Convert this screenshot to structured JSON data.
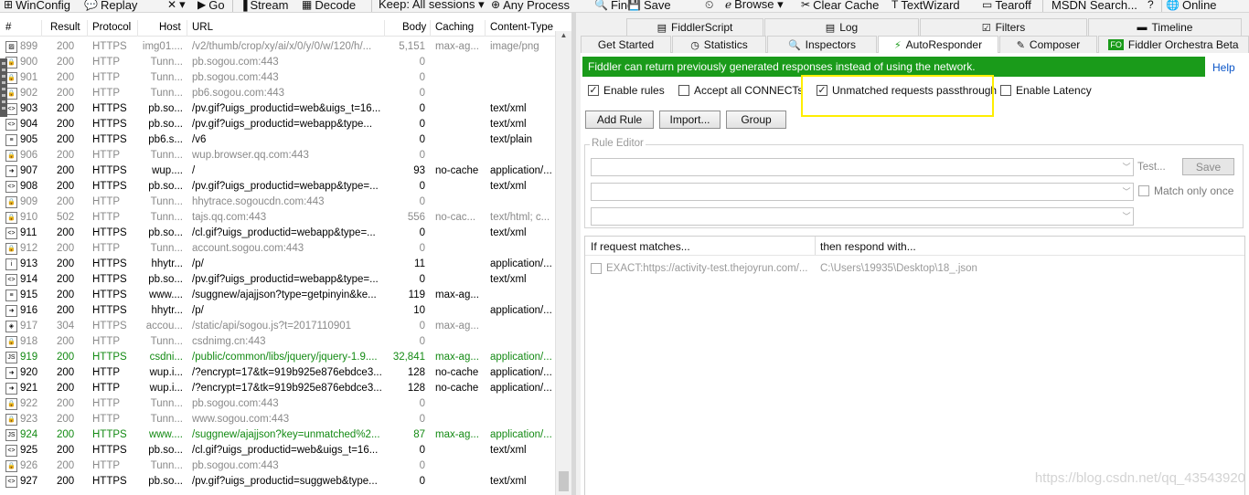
{
  "toolbar": {
    "items": [
      {
        "icon": "winconfig-icon",
        "glyph": "⊞",
        "label": "WinConfig"
      },
      {
        "icon": "replay-icon",
        "glyph": "💬",
        "label": "Replay"
      },
      {
        "icon": "remove-icon",
        "glyph": "✕",
        "label": "▾"
      },
      {
        "icon": "go-icon",
        "glyph": "▶",
        "label": "Go"
      },
      {
        "icon": "stream-icon",
        "glyph": "▐",
        "label": "Stream"
      },
      {
        "icon": "decode-icon",
        "glyph": "▦",
        "label": "Decode"
      },
      {
        "icon": "",
        "glyph": "",
        "label": "Keep: All sessions ▾"
      },
      {
        "icon": "target-icon",
        "glyph": "⊕",
        "label": "Any Process"
      },
      {
        "icon": "find-icon",
        "glyph": "🔍",
        "label": "Find"
      },
      {
        "icon": "save-icon",
        "glyph": "💾",
        "label": "Save"
      },
      {
        "icon": "timer-icon",
        "glyph": "⏲",
        "label": ""
      },
      {
        "icon": "browse-icon",
        "glyph": "ℯ",
        "label": "Browse ▾"
      },
      {
        "icon": "clear-cache-icon",
        "glyph": "✂",
        "label": "Clear Cache"
      },
      {
        "icon": "textwizard-icon",
        "glyph": "T",
        "label": "TextWizard"
      },
      {
        "icon": "tearoff-icon",
        "glyph": "▭",
        "label": "Tearoff"
      },
      {
        "icon": "",
        "glyph": "",
        "label": "MSDN Search..."
      },
      {
        "icon": "help-icon",
        "glyph": "?",
        "label": ""
      },
      {
        "icon": "online-icon",
        "glyph": "🌐",
        "label": "Online"
      }
    ]
  },
  "sessions": {
    "columns": {
      "num": "#",
      "result": "Result",
      "protocol": "Protocol",
      "host": "Host",
      "url": "URL",
      "body": "Body",
      "caching": "Caching",
      "ctype": "Content-Type"
    },
    "rows": [
      {
        "num": "899",
        "result": "200",
        "protocol": "HTTPS",
        "host": "img01....",
        "url": "/v2/thumb/crop/xy/ai/x/0/y/0/w/120/h/...",
        "body": "5,151",
        "caching": "max-ag...",
        "ctype": "image/png",
        "style": "grey",
        "icon": "image-icon",
        "glyph": "▨"
      },
      {
        "num": "900",
        "result": "200",
        "protocol": "HTTP",
        "host": "Tunn...",
        "url": "pb.sogou.com:443",
        "body": "0",
        "caching": "",
        "ctype": "",
        "style": "grey",
        "icon": "lock-icon",
        "glyph": "🔒"
      },
      {
        "num": "901",
        "result": "200",
        "protocol": "HTTP",
        "host": "Tunn...",
        "url": "pb.sogou.com:443",
        "body": "0",
        "caching": "",
        "ctype": "",
        "style": "grey",
        "icon": "lock-icon",
        "glyph": "🔒"
      },
      {
        "num": "902",
        "result": "200",
        "protocol": "HTTP",
        "host": "Tunn...",
        "url": "pb6.sogou.com:443",
        "body": "0",
        "caching": "",
        "ctype": "",
        "style": "grey",
        "icon": "lock-icon",
        "glyph": "🔒"
      },
      {
        "num": "903",
        "result": "200",
        "protocol": "HTTPS",
        "host": "pb.so...",
        "url": "/pv.gif?uigs_productid=web&uigs_t=16...",
        "body": "0",
        "caching": "",
        "ctype": "text/xml",
        "style": "",
        "icon": "xml-icon",
        "glyph": "<>"
      },
      {
        "num": "904",
        "result": "200",
        "protocol": "HTTPS",
        "host": "pb.so...",
        "url": "/pv.gif?uigs_productid=webapp&type...",
        "body": "0",
        "caching": "",
        "ctype": "text/xml",
        "style": "",
        "icon": "xml-icon",
        "glyph": "<>"
      },
      {
        "num": "905",
        "result": "200",
        "protocol": "HTTPS",
        "host": "pb6.s...",
        "url": "/v6",
        "body": "0",
        "caching": "",
        "ctype": "text/plain",
        "style": "",
        "icon": "text-icon",
        "glyph": "≡"
      },
      {
        "num": "906",
        "result": "200",
        "protocol": "HTTP",
        "host": "Tunn...",
        "url": "wup.browser.qq.com:443",
        "body": "0",
        "caching": "",
        "ctype": "",
        "style": "grey",
        "icon": "lock-icon",
        "glyph": "🔒"
      },
      {
        "num": "907",
        "result": "200",
        "protocol": "HTTPS",
        "host": "wup....",
        "url": "/",
        "body": "93",
        "caching": "no-cache",
        "ctype": "application/...",
        "style": "",
        "icon": "arrow-icon",
        "glyph": "➜"
      },
      {
        "num": "908",
        "result": "200",
        "protocol": "HTTPS",
        "host": "pb.so...",
        "url": "/pv.gif?uigs_productid=webapp&type=...",
        "body": "0",
        "caching": "",
        "ctype": "text/xml",
        "style": "",
        "icon": "xml-icon",
        "glyph": "<>"
      },
      {
        "num": "909",
        "result": "200",
        "protocol": "HTTP",
        "host": "Tunn...",
        "url": "hhytrace.sogoucdn.com:443",
        "body": "0",
        "caching": "",
        "ctype": "",
        "style": "grey",
        "icon": "lock-icon",
        "glyph": "🔒"
      },
      {
        "num": "910",
        "result": "502",
        "protocol": "HTTP",
        "host": "Tunn...",
        "url": "tajs.qq.com:443",
        "body": "556",
        "caching": "no-cac...",
        "ctype": "text/html; c...",
        "style": "grey",
        "icon": "lock-icon",
        "glyph": "🔒"
      },
      {
        "num": "911",
        "result": "200",
        "protocol": "HTTPS",
        "host": "pb.so...",
        "url": "/cl.gif?uigs_productid=webapp&type=...",
        "body": "0",
        "caching": "",
        "ctype": "text/xml",
        "style": "",
        "icon": "xml-icon",
        "glyph": "<>"
      },
      {
        "num": "912",
        "result": "200",
        "protocol": "HTTP",
        "host": "Tunn...",
        "url": "account.sogou.com:443",
        "body": "0",
        "caching": "",
        "ctype": "",
        "style": "grey",
        "icon": "lock-icon",
        "glyph": "🔒"
      },
      {
        "num": "913",
        "result": "200",
        "protocol": "HTTPS",
        "host": "hhytr...",
        "url": "/p/",
        "body": "11",
        "caching": "",
        "ctype": "application/...",
        "style": "",
        "icon": "info-icon",
        "glyph": "i"
      },
      {
        "num": "914",
        "result": "200",
        "protocol": "HTTPS",
        "host": "pb.so...",
        "url": "/pv.gif?uigs_productid=webapp&type=...",
        "body": "0",
        "caching": "",
        "ctype": "text/xml",
        "style": "",
        "icon": "xml-icon",
        "glyph": "<>"
      },
      {
        "num": "915",
        "result": "200",
        "protocol": "HTTPS",
        "host": "www....",
        "url": "/suggnew/ajajjson?type=getpinyin&ke...",
        "body": "119",
        "caching": "max-ag...",
        "ctype": "",
        "style": "",
        "icon": "text-icon",
        "glyph": "≡"
      },
      {
        "num": "916",
        "result": "200",
        "protocol": "HTTPS",
        "host": "hhytr...",
        "url": "/p/",
        "body": "10",
        "caching": "",
        "ctype": "application/...",
        "style": "",
        "icon": "arrow-icon",
        "glyph": "➜"
      },
      {
        "num": "917",
        "result": "304",
        "protocol": "HTTPS",
        "host": "accou...",
        "url": "/static/api/sogou.js?t=2017110901",
        "body": "0",
        "caching": "max-ag...",
        "ctype": "",
        "style": "grey",
        "icon": "diamond-icon",
        "glyph": "◈"
      },
      {
        "num": "918",
        "result": "200",
        "protocol": "HTTP",
        "host": "Tunn...",
        "url": "csdnimg.cn:443",
        "body": "0",
        "caching": "",
        "ctype": "",
        "style": "grey",
        "icon": "lock-icon",
        "glyph": "🔒"
      },
      {
        "num": "919",
        "result": "200",
        "protocol": "HTTPS",
        "host": "csdni...",
        "url": "/public/common/libs/jquery/jquery-1.9....",
        "body": "32,841",
        "caching": "max-ag...",
        "ctype": "application/...",
        "style": "green",
        "icon": "js-icon",
        "glyph": "JS"
      },
      {
        "num": "920",
        "result": "200",
        "protocol": "HTTP",
        "host": "wup.i...",
        "url": "/?encrypt=17&tk=919b925e876ebdce3...",
        "body": "128",
        "caching": "no-cache",
        "ctype": "application/...",
        "style": "",
        "icon": "arrow-icon",
        "glyph": "➜"
      },
      {
        "num": "921",
        "result": "200",
        "protocol": "HTTP",
        "host": "wup.i...",
        "url": "/?encrypt=17&tk=919b925e876ebdce3...",
        "body": "128",
        "caching": "no-cache",
        "ctype": "application/...",
        "style": "",
        "icon": "arrow-icon",
        "glyph": "➜"
      },
      {
        "num": "922",
        "result": "200",
        "protocol": "HTTP",
        "host": "Tunn...",
        "url": "pb.sogou.com:443",
        "body": "0",
        "caching": "",
        "ctype": "",
        "style": "grey",
        "icon": "lock-icon",
        "glyph": "🔒"
      },
      {
        "num": "923",
        "result": "200",
        "protocol": "HTTP",
        "host": "Tunn...",
        "url": "www.sogou.com:443",
        "body": "0",
        "caching": "",
        "ctype": "",
        "style": "grey",
        "icon": "lock-icon",
        "glyph": "🔒"
      },
      {
        "num": "924",
        "result": "200",
        "protocol": "HTTPS",
        "host": "www....",
        "url": "/suggnew/ajajjson?key=unmatched%2...",
        "body": "87",
        "caching": "max-ag...",
        "ctype": "application/...",
        "style": "green",
        "icon": "js-icon",
        "glyph": "JS"
      },
      {
        "num": "925",
        "result": "200",
        "protocol": "HTTPS",
        "host": "pb.so...",
        "url": "/cl.gif?uigs_productid=web&uigs_t=16...",
        "body": "0",
        "caching": "",
        "ctype": "text/xml",
        "style": "",
        "icon": "xml-icon",
        "glyph": "<>"
      },
      {
        "num": "926",
        "result": "200",
        "protocol": "HTTP",
        "host": "Tunn...",
        "url": "pb.sogou.com:443",
        "body": "0",
        "caching": "",
        "ctype": "",
        "style": "grey",
        "icon": "lock-icon",
        "glyph": "🔒"
      },
      {
        "num": "927",
        "result": "200",
        "protocol": "HTTPS",
        "host": "pb.so...",
        "url": "/pv.gif?uigs_productid=suggweb&type...",
        "body": "0",
        "caching": "",
        "ctype": "text/xml",
        "style": "",
        "icon": "xml-icon",
        "glyph": "<>"
      }
    ]
  },
  "tabs_row1": [
    {
      "label": "FiddlerScript",
      "icon": "script-icon",
      "glyph": "▤"
    },
    {
      "label": "Log",
      "icon": "log-icon",
      "glyph": "▤"
    },
    {
      "label": "Filters",
      "icon": "filters-checkbox-icon",
      "glyph": "☑"
    },
    {
      "label": "Timeline",
      "icon": "timeline-icon",
      "glyph": "▬"
    }
  ],
  "tabs_row2": [
    {
      "label": "Get Started",
      "icon": "",
      "glyph": "",
      "active": false
    },
    {
      "label": "Statistics",
      "icon": "statistics-icon",
      "glyph": "◷",
      "active": false
    },
    {
      "label": "Inspectors",
      "icon": "inspectors-icon",
      "glyph": "🔍",
      "active": false
    },
    {
      "label": "AutoResponder",
      "icon": "lightning-icon",
      "glyph": "⚡",
      "active": true
    },
    {
      "label": "Composer",
      "icon": "composer-icon",
      "glyph": "✎",
      "active": false
    },
    {
      "label": "Fiddler Orchestra Beta",
      "icon": "fo-icon",
      "glyph": "FO",
      "active": false
    }
  ],
  "autoresponder": {
    "banner": "Fiddler can return previously generated responses instead of using the network.",
    "help": "Help",
    "enable_rules": {
      "label": "Enable rules",
      "checked": true
    },
    "accept_connects": {
      "label": "Accept all CONNECTs",
      "checked": false
    },
    "unmatched_passthrough": {
      "label": "Unmatched requests passthrough",
      "checked": true
    },
    "enable_latency": {
      "label": "Enable Latency",
      "checked": false
    },
    "add_rule": "Add Rule",
    "import": "Import...",
    "group": "Group",
    "rule_editor_legend": "Rule Editor",
    "test": "Test...",
    "save": "Save",
    "match_only_once": {
      "label": "Match only once",
      "checked": false
    },
    "list_headers": {
      "matches": "If request matches...",
      "respond": "then respond with..."
    },
    "rules": [
      {
        "match": "EXACT:https://activity-test.thejoyrun.com/...",
        "respond": "C:\\Users\\19935\\Desktop\\18_.json",
        "checked": false
      }
    ]
  },
  "colors": {
    "banner": "#1a9b1a",
    "highlight": "#ffee00",
    "green_row": "#138a13"
  },
  "watermark": "https://blog.csdn.net/qq_43543920"
}
